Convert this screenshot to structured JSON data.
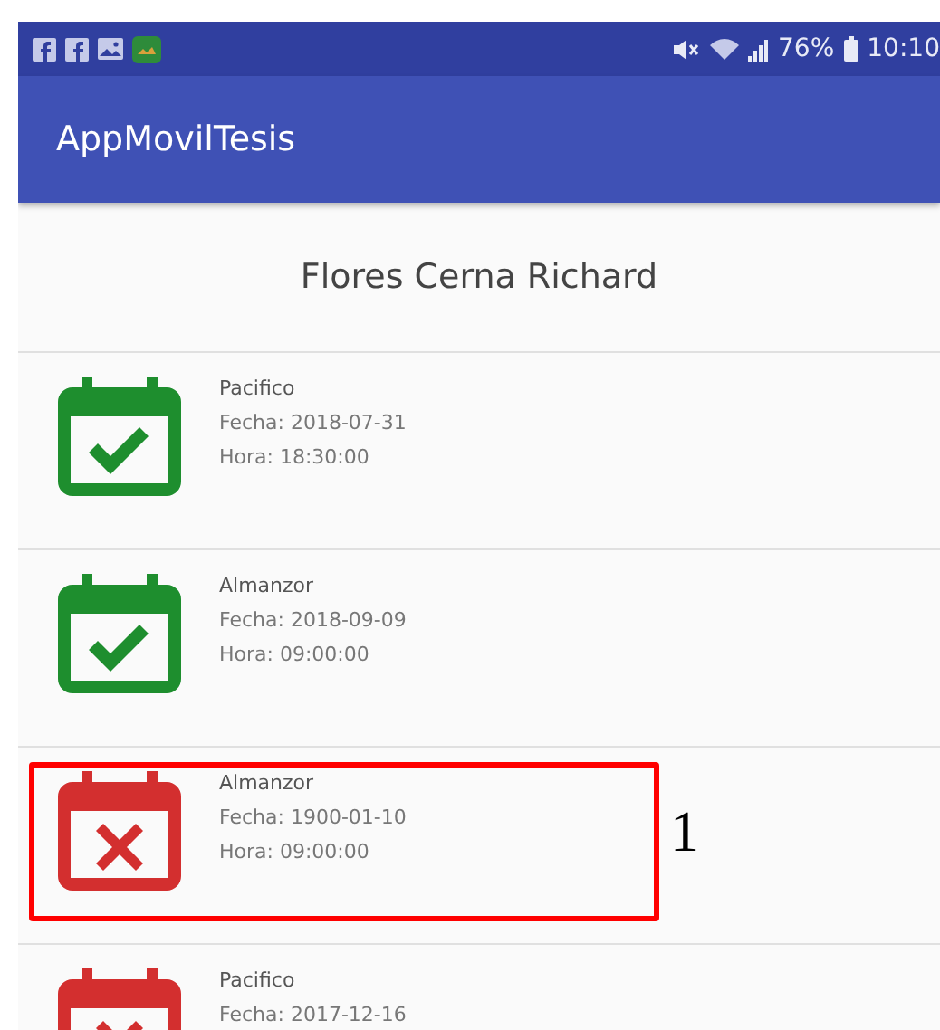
{
  "status_bar": {
    "notification_icons": [
      {
        "kind": "facebook"
      },
      {
        "kind": "facebook"
      },
      {
        "kind": "image"
      },
      {
        "kind": "app"
      }
    ],
    "battery": "76%",
    "time": "10:10"
  },
  "app_bar": {
    "title": "AppMovilTesis"
  },
  "header": {
    "name": "Flores Cerna Richard"
  },
  "appointments": [
    {
      "kind": "confirmed",
      "place": "Pacifico",
      "date": "Fecha: 2018-07-31",
      "time": "Hora: 18:30:00",
      "highlighted": false
    },
    {
      "kind": "confirmed",
      "place": "Almanzor",
      "date": "Fecha: 2018-09-09",
      "time": "Hora: 09:00:00",
      "highlighted": false
    },
    {
      "kind": "cancelled",
      "place": "Almanzor",
      "date": "Fecha: 1900-01-10",
      "time": "Hora: 09:00:00",
      "highlighted": true,
      "callout": "1"
    },
    {
      "kind": "cancelled",
      "place": "Pacifico",
      "date": "Fecha: 2017-12-16",
      "highlighted": false
    }
  ]
}
